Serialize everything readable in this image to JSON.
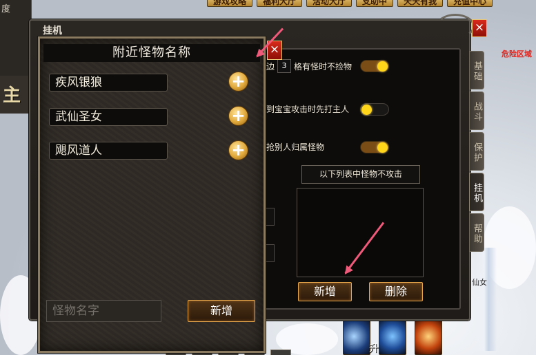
{
  "world": {
    "top_buttons": [
      "游戏攻略",
      "福利大厅",
      "活动大厅",
      "支助中",
      "天天有我",
      "充值中心"
    ],
    "left_panel_text": "度",
    "left_panel_big": "主",
    "danger_text": "危险区域",
    "side_label": "仙女",
    "skill_label": "升"
  },
  "window": {
    "title": "挂机",
    "close": "×",
    "row_pick_prefix": "边",
    "row_pick_value": "3",
    "row_pick_suffix": "格有怪时不捡物",
    "row_pet": "到宝宝攻击时先打主人",
    "row_grab": "抢别人归属怪物",
    "no_attack_caption": "以下列表中怪物不攻击",
    "btn_add": "新增",
    "btn_delete": "删除",
    "toggles": {
      "pick": true,
      "pet": false,
      "grab": true
    }
  },
  "tabs": [
    {
      "label": "基础",
      "active": false
    },
    {
      "label": "战斗",
      "active": false
    },
    {
      "label": "保护",
      "active": false
    },
    {
      "label": "挂机",
      "active": true
    },
    {
      "label": "帮助",
      "active": false
    }
  ],
  "popup": {
    "title": "附近怪物名称",
    "close": "×",
    "monsters": [
      "疾风银狼",
      "武仙圣女",
      "飓风道人"
    ],
    "plus": "+",
    "input_placeholder": "怪物名字",
    "btn_add": "新增"
  },
  "colors": {
    "accent_gold": "#e5a64c",
    "toggle_knob": "#ffd61a",
    "close_red": "#d82a1c",
    "arrow_pink": "#f05a7a"
  }
}
